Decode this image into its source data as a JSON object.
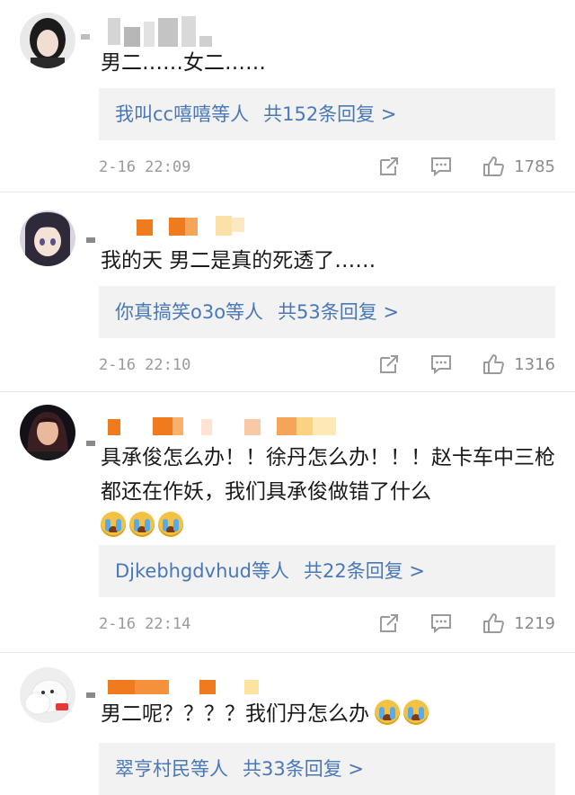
{
  "comments": [
    {
      "text": "男二……女二……",
      "reply_users": "我叫cc嘻嘻等人",
      "reply_count": "共152条回复 >",
      "time": "2-16 22:09",
      "likes": "1785"
    },
    {
      "text": "我的天 男二是真的死透了……",
      "reply_users": "你真搞笑o3o等人",
      "reply_count": "共53条回复 >",
      "time": "2-16 22:10",
      "likes": "1316"
    },
    {
      "text": "具承俊怎么办！！徐丹怎么办！！！赵卡车中三枪都还在作妖，我们具承俊做错了什么",
      "reply_users": "Djkebhgdvhud等人",
      "reply_count": "共22条回复 >",
      "time": "2-16 22:14",
      "likes": "1219"
    },
    {
      "text": "男二呢？？？？我们丹怎么办",
      "reply_users": "翠亨村民等人",
      "reply_count": "共33条回复 >",
      "time": "",
      "likes": ""
    }
  ],
  "icons": {
    "share": "share-icon",
    "comment": "comment-icon",
    "like": "thumbs-up-icon",
    "emoji": "crying-face-emoji"
  },
  "colors": {
    "link": "#4a78b7",
    "reply_bg": "#f2f2f2",
    "meta": "#999999",
    "mosaic_orange": "#f07a1e",
    "mosaic_gray": "#cfcfcf"
  }
}
